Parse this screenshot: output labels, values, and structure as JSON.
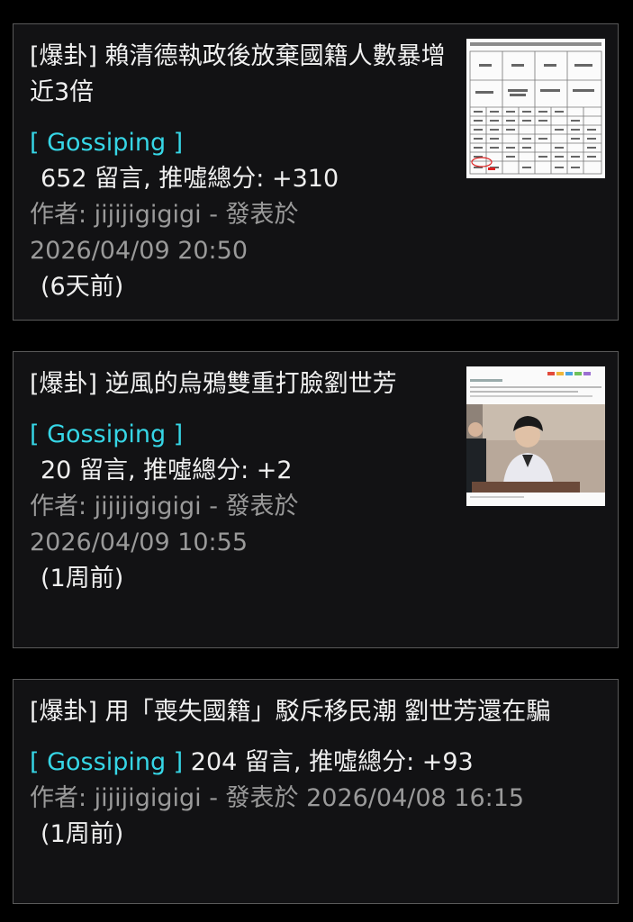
{
  "posts": [
    {
      "title": "[爆卦] 賴清德執政後放棄國籍人數暴增近3倍",
      "board": "[ Gossiping ]",
      "stats": "652 留言, 推噓總分: +310",
      "author_line": "作者: jijijigigigi - 發表於",
      "datetime": "2026/04/09 20:50",
      "ago": "(6天前)",
      "thumbnail": "table-screenshot-thumbnail"
    },
    {
      "title": "[爆卦] 逆風的烏鴉雙重打臉劉世芳",
      "board": "[ Gossiping ]",
      "stats": "20 留言, 推噓總分: +2",
      "author_line": "作者: jijijigigigi - 發表於",
      "datetime": "2026/04/09 10:55",
      "ago": "(1周前)",
      "thumbnail": "news-photo-thumbnail"
    },
    {
      "title": "[爆卦] 用「喪失國籍」駁斥移民潮 劉世芳還在騙",
      "board": "[ Gossiping ]",
      "stats": "204 留言, 推噓總分: +93",
      "author_line": "作者: jijijigigigi - 發表於 2026/04/08 16:15",
      "ago": "(1周前)"
    }
  ],
  "colors": {
    "background": "#000000",
    "card": "#121214",
    "border": "#5a5a5a",
    "board_accent": "#36d6e6",
    "meta_text": "#9a9a9a"
  }
}
